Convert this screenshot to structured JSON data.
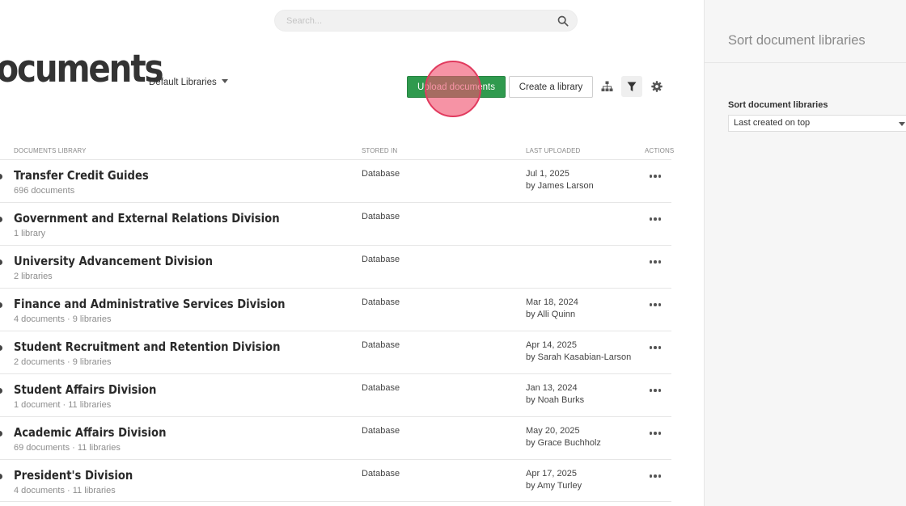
{
  "search": {
    "placeholder": "Search..."
  },
  "header": {
    "title": "Documents",
    "library_selector": "Default Libraries"
  },
  "toolbar": {
    "upload_label": "Upload documents",
    "create_label": "Create a library"
  },
  "icons": {
    "search": "search-icon",
    "hierarchy": "sitemap-icon",
    "filter": "filter-icon",
    "settings": "gear-icon",
    "more": "more-horizontal-icon"
  },
  "colors": {
    "upload_button": "#2f9a4e",
    "click_marker": "#e13a5e"
  },
  "table": {
    "columns": [
      "Documents Library",
      "Stored in",
      "Last uploaded",
      "Actions"
    ],
    "rows": [
      {
        "name": "Transfer Credit Guides",
        "meta": "696 documents",
        "stored": "Database",
        "date": "Jul 1, 2025",
        "by": "by James Larson"
      },
      {
        "name": "Government and External Relations Division",
        "meta": "1 library",
        "stored": "Database",
        "date": "",
        "by": ""
      },
      {
        "name": "University Advancement Division",
        "meta": "2 libraries",
        "stored": "Database",
        "date": "",
        "by": ""
      },
      {
        "name": "Finance and Administrative Services Division",
        "meta": "4 documents · 9 libraries",
        "stored": "Database",
        "date": "Mar 18, 2024",
        "by": "by Alli Quinn"
      },
      {
        "name": "Student Recruitment and Retention Division",
        "meta": "2 documents · 9 libraries",
        "stored": "Database",
        "date": "Apr 14, 2025",
        "by": "by Sarah Kasabian-Larson"
      },
      {
        "name": "Student Affairs Division",
        "meta": "1 document · 11 libraries",
        "stored": "Database",
        "date": "Jan 13, 2024",
        "by": "by Noah Burks"
      },
      {
        "name": "Academic Affairs Division",
        "meta": "69 documents · 11 libraries",
        "stored": "Database",
        "date": "May 20, 2025",
        "by": "by Grace Buchholz"
      },
      {
        "name": "President's Division",
        "meta": "4 documents · 11 libraries",
        "stored": "Database",
        "date": "Apr 17, 2025",
        "by": "by Amy Turley"
      }
    ]
  },
  "side_panel": {
    "title": "Sort document libraries",
    "label": "Sort document libraries",
    "selected": "Last created on top"
  }
}
